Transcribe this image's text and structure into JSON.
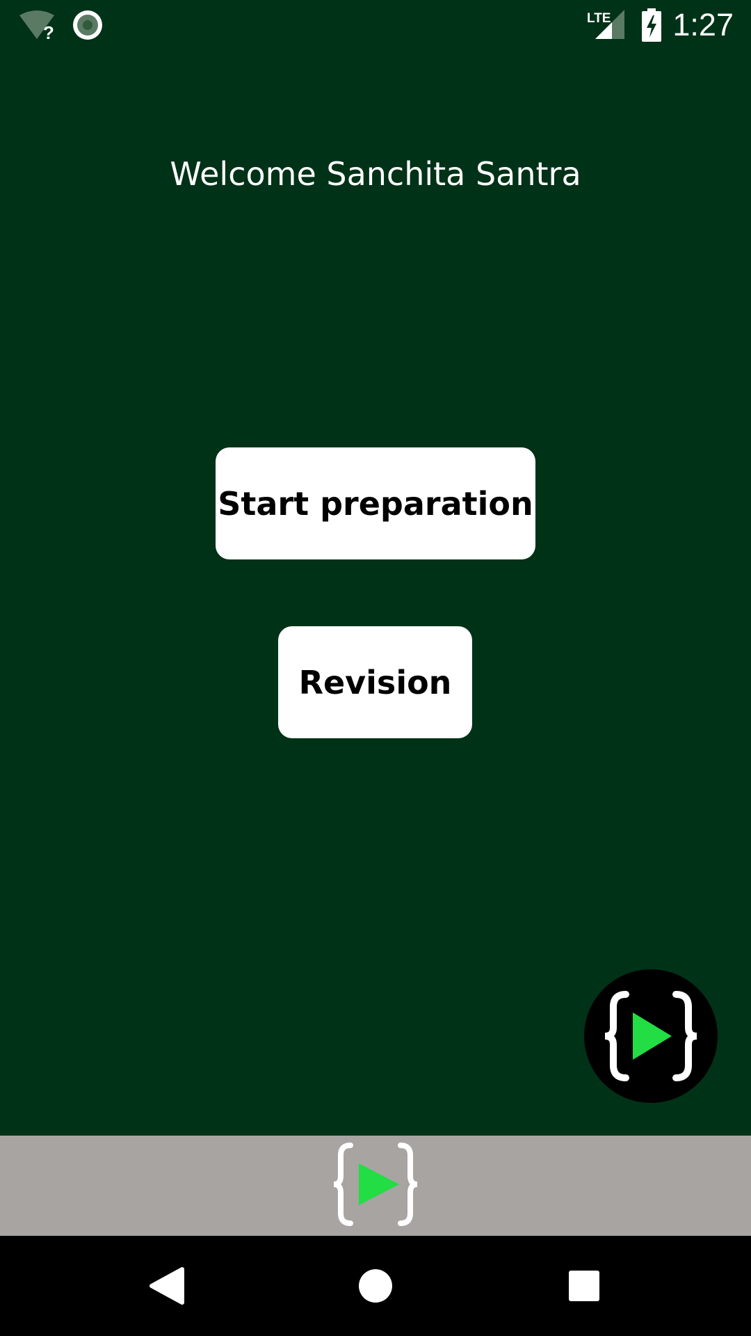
{
  "status_bar": {
    "time": "1:27",
    "icons": [
      "wifi-unknown-icon",
      "sync-icon",
      "lte-signal-icon",
      "battery-charging-icon"
    ]
  },
  "main": {
    "welcome_text": "Welcome Sanchita Santra",
    "start_button_label": "Start preparation",
    "revision_button_label": "Revision"
  },
  "fab": {
    "icon": "brace-play-logo-icon"
  },
  "banner": {
    "icon": "brace-play-logo-icon"
  },
  "nav_bar": {
    "icons": [
      "back-icon",
      "home-icon",
      "recents-icon"
    ]
  },
  "colors": {
    "background": "#003218",
    "button": "#ffffff",
    "accent_play": "#22dd44",
    "banner": "#a8a4a2",
    "nav_bar": "#000000"
  }
}
